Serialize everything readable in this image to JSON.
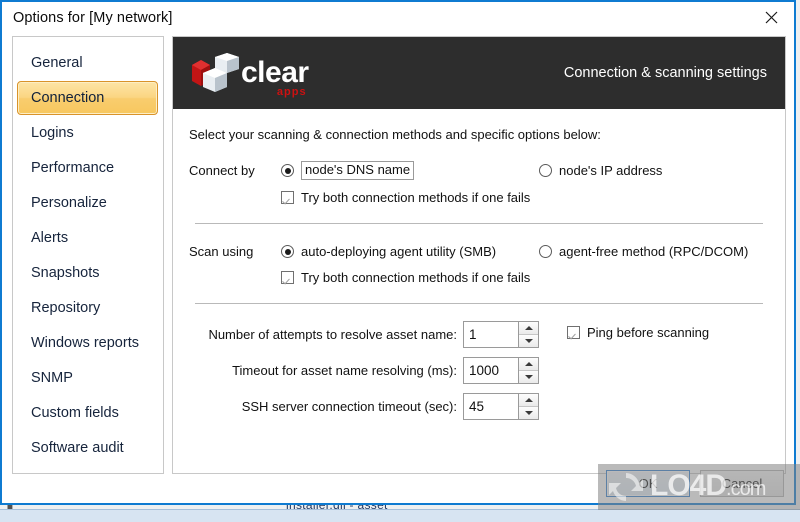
{
  "window": {
    "title": "Options for [My network]",
    "close_icon": "close-icon"
  },
  "sidebar": {
    "items": [
      {
        "label": "General",
        "selected": false
      },
      {
        "label": "Connection",
        "selected": true
      },
      {
        "label": "Logins",
        "selected": false
      },
      {
        "label": "Performance",
        "selected": false
      },
      {
        "label": "Personalize",
        "selected": false
      },
      {
        "label": "Alerts",
        "selected": false
      },
      {
        "label": "Snapshots",
        "selected": false
      },
      {
        "label": "Repository",
        "selected": false
      },
      {
        "label": "Windows reports",
        "selected": false
      },
      {
        "label": "SNMP",
        "selected": false
      },
      {
        "label": "Custom fields",
        "selected": false
      },
      {
        "label": "Software audit",
        "selected": false
      }
    ]
  },
  "banner": {
    "brand_name": "clear",
    "brand_sub": "apps",
    "title": "Connection & scanning settings",
    "background": "#2d2d2d",
    "accent": "#cc1111"
  },
  "form": {
    "intro": "Select your scanning & connection methods and specific options below:",
    "connect_by": {
      "label": "Connect by",
      "options": [
        {
          "label": "node's DNS name",
          "selected": true,
          "focused": true
        },
        {
          "label": "node's IP address",
          "selected": false,
          "focused": false
        }
      ],
      "fallback": {
        "label": "Try both connection methods if one fails",
        "checked": true
      }
    },
    "scan_using": {
      "label": "Scan using",
      "options": [
        {
          "label": "auto-deploying agent utility (SMB)",
          "selected": true,
          "focused": false
        },
        {
          "label": "agent-free method (RPC/DCOM)",
          "selected": false,
          "focused": false
        }
      ],
      "fallback": {
        "label": "Try both connection methods if one fails",
        "checked": true
      }
    },
    "numbers": [
      {
        "label": "Number of attempts to resolve asset name:",
        "value": "1"
      },
      {
        "label": "Timeout for asset name resolving (ms):",
        "value": "1000"
      },
      {
        "label": "SSH server connection timeout (sec):",
        "value": "45"
      }
    ],
    "ping": {
      "label": "Ping before scanning",
      "checked": true
    }
  },
  "footer": {
    "ok_label": "OK",
    "cancel_label": "Cancel"
  },
  "watermark": {
    "text": "LO4D",
    "suffix": ".com"
  },
  "backdrop": {
    "partial_text": "installer.dll - asset"
  }
}
